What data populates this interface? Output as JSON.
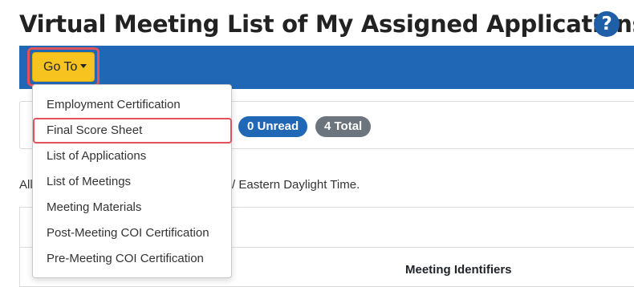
{
  "page": {
    "title": "Virtual Meeting List of My Assigned Applications",
    "help_icon": "?"
  },
  "navbar": {
    "goto_label": "Go To",
    "goto_icon": "caret-down-icon"
  },
  "dropdown": {
    "items": [
      {
        "label": "Employment Certification",
        "highlighted": false
      },
      {
        "label": "Final Score Sheet",
        "highlighted": true
      },
      {
        "label": "List of Applications",
        "highlighted": false
      },
      {
        "label": "List of Meetings",
        "highlighted": false
      },
      {
        "label": "Meeting Materials",
        "highlighted": false
      },
      {
        "label": "Post-Meeting COI Certification",
        "highlighted": false
      },
      {
        "label": "Pre-Meeting COI Certification",
        "highlighted": false
      }
    ]
  },
  "badges": {
    "unread": "0 Unread",
    "total": "4 Total"
  },
  "info": {
    "prefix": "All",
    "suffix": "e/ Eastern Daylight Time."
  },
  "table": {
    "columns": [
      "Meeting Identifiers"
    ]
  },
  "colors": {
    "navbar": "#2067b6",
    "goto_button": "#f7c41f",
    "highlight_outline": "#e0525c",
    "badge_unread": "#2067b6",
    "badge_total": "#6c757d"
  }
}
